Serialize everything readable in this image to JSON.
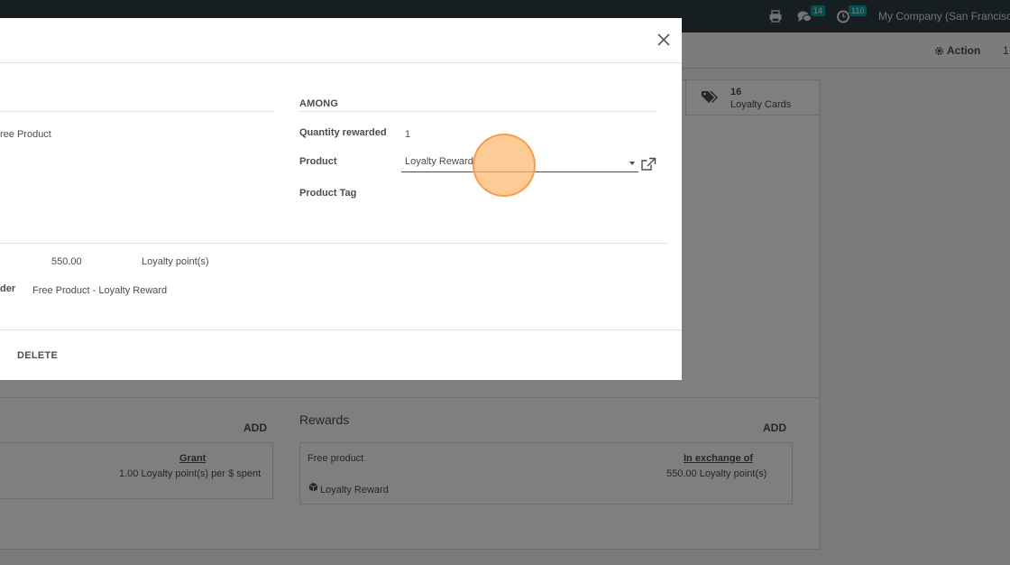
{
  "navbar": {
    "chat_count": "14",
    "activity_count": "110",
    "company": "My Company (San Francisco"
  },
  "control_panel": {
    "action_label": "Action",
    "pager": "1"
  },
  "sheet": {
    "loyalty_cards_count": "16",
    "loyalty_cards_label": "Loyalty Cards",
    "rules": {
      "add_label": "ADD",
      "grant_label": "Grant",
      "grant_value": "1.00 Loyalty point(s) per $ spent"
    },
    "rewards": {
      "title": "Rewards",
      "add_label": "ADD",
      "reward_type": "Free product",
      "exchange_label": "In exchange of",
      "exchange_value": "550.00 Loyalty point(s)",
      "reward_product": "Loyalty Reward"
    }
  },
  "modal": {
    "left": {
      "reward_type_partial": "ree Product"
    },
    "among": {
      "title": "AMONG",
      "quantity_label": "Quantity rewarded",
      "quantity_value": "1",
      "product_label": "Product",
      "product_value": "Loyalty Reward",
      "product_tag_label": "Product Tag"
    },
    "points": {
      "value": "550.00",
      "unit": "Loyalty point(s)"
    },
    "description": {
      "label_partial": "der",
      "value": "Free Product - Loyalty Reward"
    },
    "footer": {
      "delete_label": "DELETE"
    }
  },
  "colors": {
    "navbar": "#2d3d45",
    "badge": "#00a09d",
    "click_indicator": "#fdba74"
  }
}
